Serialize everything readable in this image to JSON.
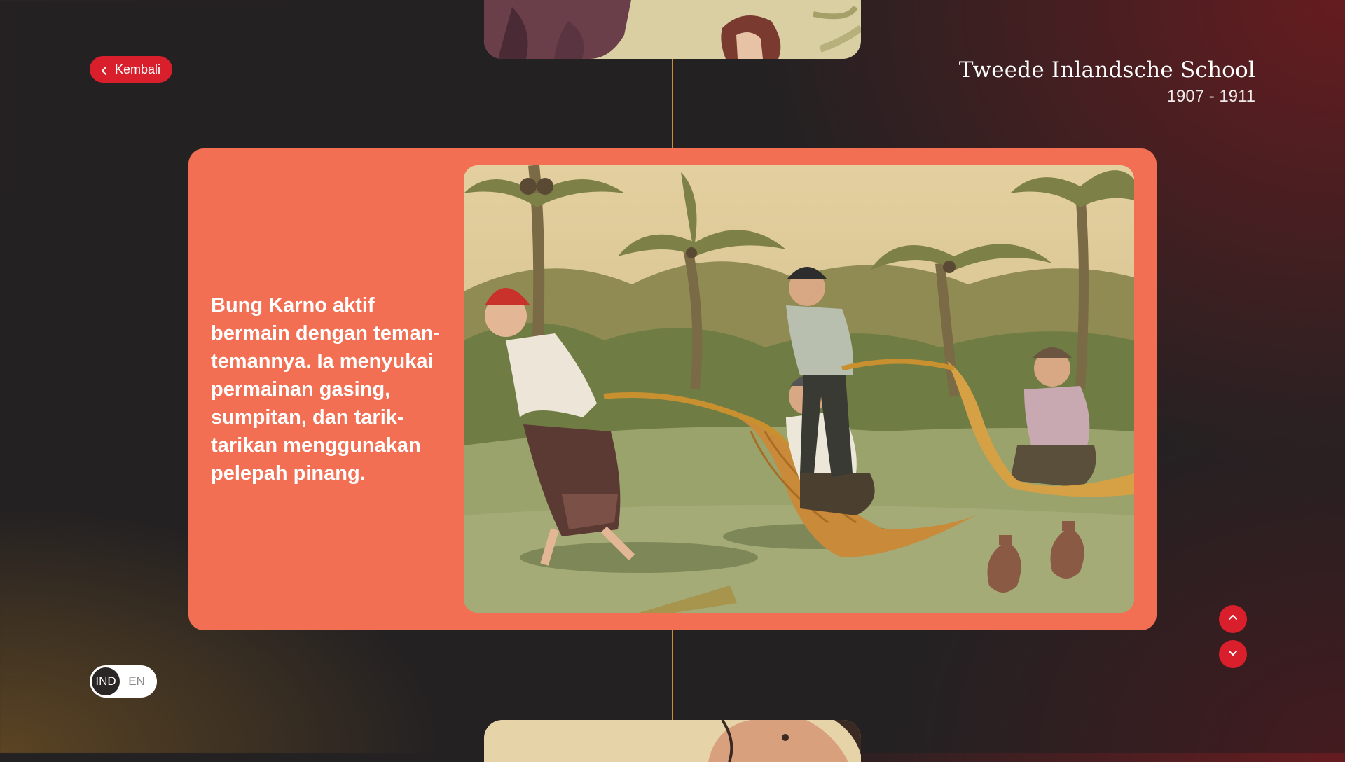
{
  "header": {
    "back_label": "Kembali",
    "title": "Tweede Inlandsche School",
    "years": "1907 - 1911"
  },
  "story": {
    "text": "Bung Karno aktif bermain dengan teman-temannya. Ia menyukai permainan gasing, sumpitan, dan tarik-tarikan menggunakan pelepah pinang."
  },
  "language": {
    "options": [
      "IND",
      "EN"
    ],
    "selected": "IND"
  },
  "colors": {
    "accent": "#d81f2b",
    "card": "#f26f53",
    "timeline": "#c98c3c"
  },
  "icons": {
    "back": "chevron-left-icon",
    "up": "chevron-up-icon",
    "down": "chevron-down-icon"
  }
}
